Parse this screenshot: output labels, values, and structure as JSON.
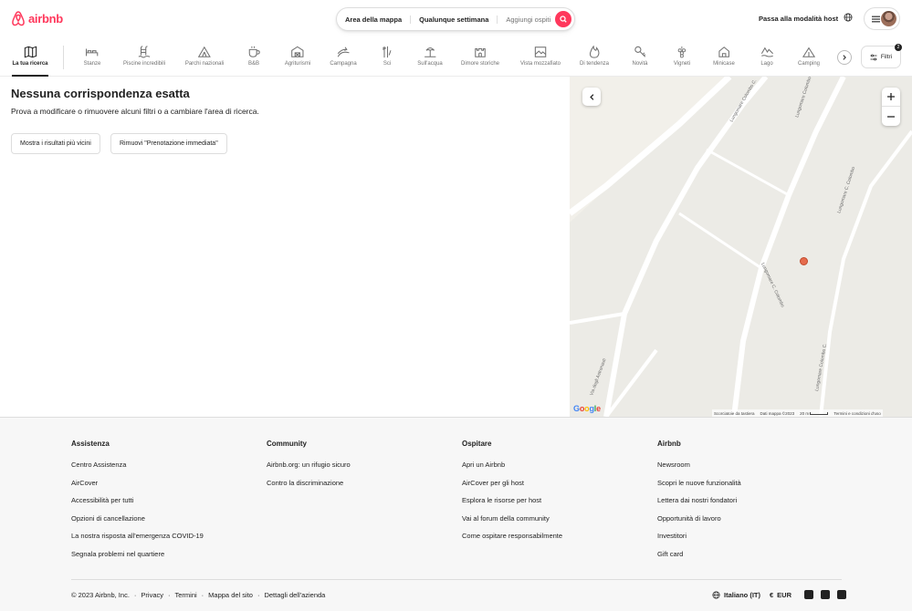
{
  "header": {
    "logo_text": "airbnb",
    "brand_color": "#FF385C",
    "search": {
      "area": "Area della mappa",
      "week": "Qualunque settimana",
      "guests": "Aggiungi ospiti"
    },
    "host_link": "Passa alla modalità host"
  },
  "categories": [
    {
      "label": "La tua ricerca",
      "icon": "map-icon",
      "active": true
    },
    {
      "label": "Stanze",
      "icon": "bed-icon"
    },
    {
      "label": "Piscine incredibili",
      "icon": "pool-icon"
    },
    {
      "label": "Parchi nazionali",
      "icon": "tent-icon"
    },
    {
      "label": "B&B",
      "icon": "coffee-icon"
    },
    {
      "label": "Agriturismi",
      "icon": "barn-icon"
    },
    {
      "label": "Campagna",
      "icon": "field-icon"
    },
    {
      "label": "Sci",
      "icon": "ski-icon"
    },
    {
      "label": "Sull'acqua",
      "icon": "beach-icon"
    },
    {
      "label": "Dimore storiche",
      "icon": "castle-icon"
    },
    {
      "label": "Vista mozzafiato",
      "icon": "view-icon"
    },
    {
      "label": "Di tendenza",
      "icon": "fire-icon"
    },
    {
      "label": "Novità",
      "icon": "key-icon"
    },
    {
      "label": "Vigneti",
      "icon": "grape-icon"
    },
    {
      "label": "Minicase",
      "icon": "tiny-house-icon"
    },
    {
      "label": "Lago",
      "icon": "lake-icon"
    },
    {
      "label": "Camping",
      "icon": "camping-icon"
    }
  ],
  "filters": {
    "label": "Filtri",
    "count": "2"
  },
  "results": {
    "title": "Nessuna corrispondenza esatta",
    "subtitle": "Prova a modificare o rimuovere alcuni filtri o a cambiare l'area di ricerca.",
    "buttons": [
      "Mostra i risultati più vicini",
      "Rimuovi \"Prenotazione immediata\""
    ]
  },
  "map": {
    "streets": [
      "Lungomare Colombo C.",
      "Lungomare Colombo C.",
      "Lungomare C. Colombo",
      "Lungomare C. Colombo",
      "Lungomare Colombo C.",
      "Via degli Astronauti"
    ],
    "google": "Google",
    "attribution": [
      "Scorciatoie da tastiera",
      "Dati mappa ©2023",
      "20 m",
      "Termini e condizioni d'uso"
    ]
  },
  "footer": {
    "columns": [
      {
        "title": "Assistenza",
        "links": [
          "Centro Assistenza",
          "AirCover",
          "Accessibilità per tutti",
          "Opzioni di cancellazione",
          "La nostra risposta all'emergenza COVID-19",
          "Segnala problemi nel quartiere"
        ]
      },
      {
        "title": "Community",
        "links": [
          "Airbnb.org: un rifugio sicuro",
          "Contro la discriminazione"
        ]
      },
      {
        "title": "Ospitare",
        "links": [
          "Apri un Airbnb",
          "AirCover per gli host",
          "Esplora le risorse per host",
          "Vai al forum della community",
          "Come ospitare responsabilmente"
        ]
      },
      {
        "title": "Airbnb",
        "links": [
          "Newsroom",
          "Scopri le nuove funzionalità",
          "Lettera dai nostri fondatori",
          "Opportunità di lavoro",
          "Investitori",
          "Gift card"
        ]
      }
    ],
    "copyright": "© 2023 Airbnb, Inc.",
    "legal": [
      "Privacy",
      "Termini",
      "Mappa del sito",
      "Dettagli dell'azienda"
    ],
    "language": "Italiano (IT)",
    "currency_symbol": "€",
    "currency": "EUR"
  }
}
